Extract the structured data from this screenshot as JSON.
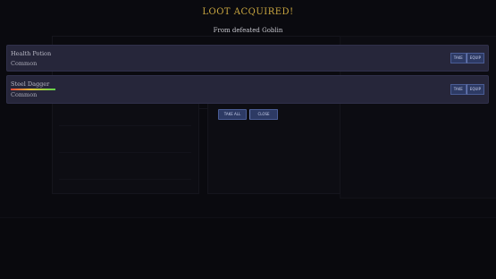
{
  "dialog": {
    "title": "LOOT ACQUIRED!",
    "subtitle": "From defeated Goblin"
  },
  "items": [
    {
      "name": "Health Potion",
      "rarity": "Common",
      "buttons": {
        "take": "TAKE",
        "equip": "EQUIP"
      }
    },
    {
      "name": "Steel Dagger",
      "rarity": "Common",
      "durability_bar_shown": true,
      "buttons": {
        "take": "TAKE",
        "equip": "EQUIP"
      }
    }
  ],
  "footer": {
    "take_all_label": "TAKE ALL",
    "close_label": "CLOSE"
  },
  "colors": {
    "title": "#c9a640",
    "item_panel": "#26263a",
    "button": "#2d3a64"
  }
}
